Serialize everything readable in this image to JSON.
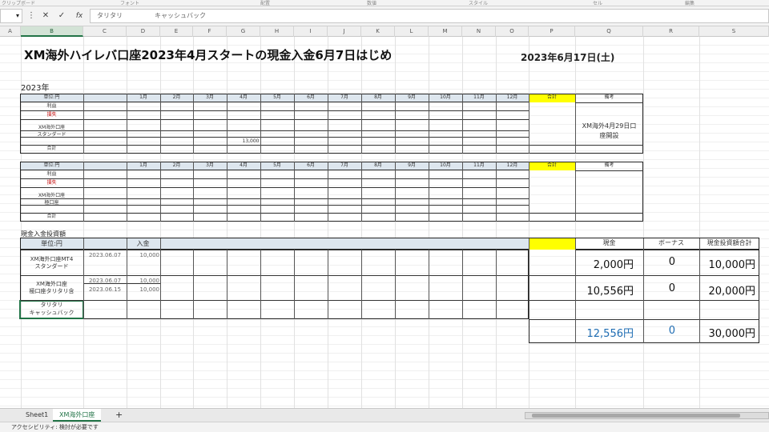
{
  "ribbon": {
    "groups": [
      "クリップボード",
      "フォント",
      "配置",
      "数値",
      "スタイル",
      "セル",
      "編集"
    ]
  },
  "formula_bar": {
    "name_box": "",
    "cancel": "✕",
    "enter": "✓",
    "fx": "fx",
    "content_1": "タリタリ",
    "content_2": "キャッシュバック"
  },
  "columns": [
    "A",
    "B",
    "C",
    "D",
    "E",
    "F",
    "G",
    "H",
    "I",
    "J",
    "K",
    "L",
    "M",
    "N",
    "O",
    "P",
    "Q",
    "R",
    "S"
  ],
  "selected_column": "B",
  "sheet": {
    "title": "XM海外ハイレバ口座2023年4月スタートの現金入金6月7日はじめ",
    "date": "2023年6月17日(土)",
    "year_label": "2023年",
    "section2_label": "現金入金投資額"
  },
  "table1": {
    "unit": "単位:円",
    "months": [
      "1月",
      "2月",
      "3月",
      "4月",
      "5月",
      "6月",
      "7月",
      "8月",
      "9月",
      "10月",
      "11月",
      "12月"
    ],
    "total_header": "合計",
    "note_header": "備考",
    "rows": [
      "利益",
      "損失",
      "XM海外口座",
      "スタンダード",
      "合計"
    ],
    "value_apr": "13,000",
    "note": [
      "XM海外4月29日口",
      "座開設"
    ]
  },
  "table2": {
    "unit": "単位:円",
    "months": [
      "1月",
      "2月",
      "3月",
      "4月",
      "5月",
      "6月",
      "7月",
      "8月",
      "9月",
      "10月",
      "11月",
      "12月"
    ],
    "total_header": "合計",
    "note_header": "備考",
    "rows": [
      "利益",
      "損失",
      "XM海外口座",
      "極口座",
      "合計"
    ]
  },
  "table3": {
    "unit": "単位:円",
    "deposit_header": "入金",
    "groups": [
      {
        "name": [
          "XM海外口座MT4",
          "スタンダード"
        ],
        "entries": [
          {
            "date": "2023.06.07",
            "amount": "10,000"
          }
        ]
      },
      {
        "name": [
          "XM海外口座",
          "極口座タリタリ含"
        ],
        "entries": [
          {
            "date": "2023.06.07",
            "amount": "10,000"
          },
          {
            "date": "2023.06.15",
            "amount": "10,000"
          }
        ]
      },
      {
        "name": [
          "タリタリ",
          "キャッシュバック"
        ],
        "entries": []
      }
    ]
  },
  "summary": {
    "headers": [
      "現金",
      "ボーナス",
      "現金投資額合計"
    ],
    "rows": [
      {
        "cash": "2,000円",
        "bonus": "0",
        "total": "10,000円"
      },
      {
        "cash": "10,556円",
        "bonus": "0",
        "total": "20,000円"
      }
    ],
    "totals": {
      "cash": "12,556円",
      "bonus": "0",
      "total": "30,000円"
    }
  },
  "tabs": [
    "Sheet1",
    "XM海外口座"
  ],
  "add_sheet": "+",
  "status_text": "アクセシビリティ: 検討が必要です",
  "colors": {
    "header_band": "#dde6ee",
    "highlight": "#ffff00",
    "total_blue": "#1f6db3",
    "excel_green": "#217346"
  }
}
